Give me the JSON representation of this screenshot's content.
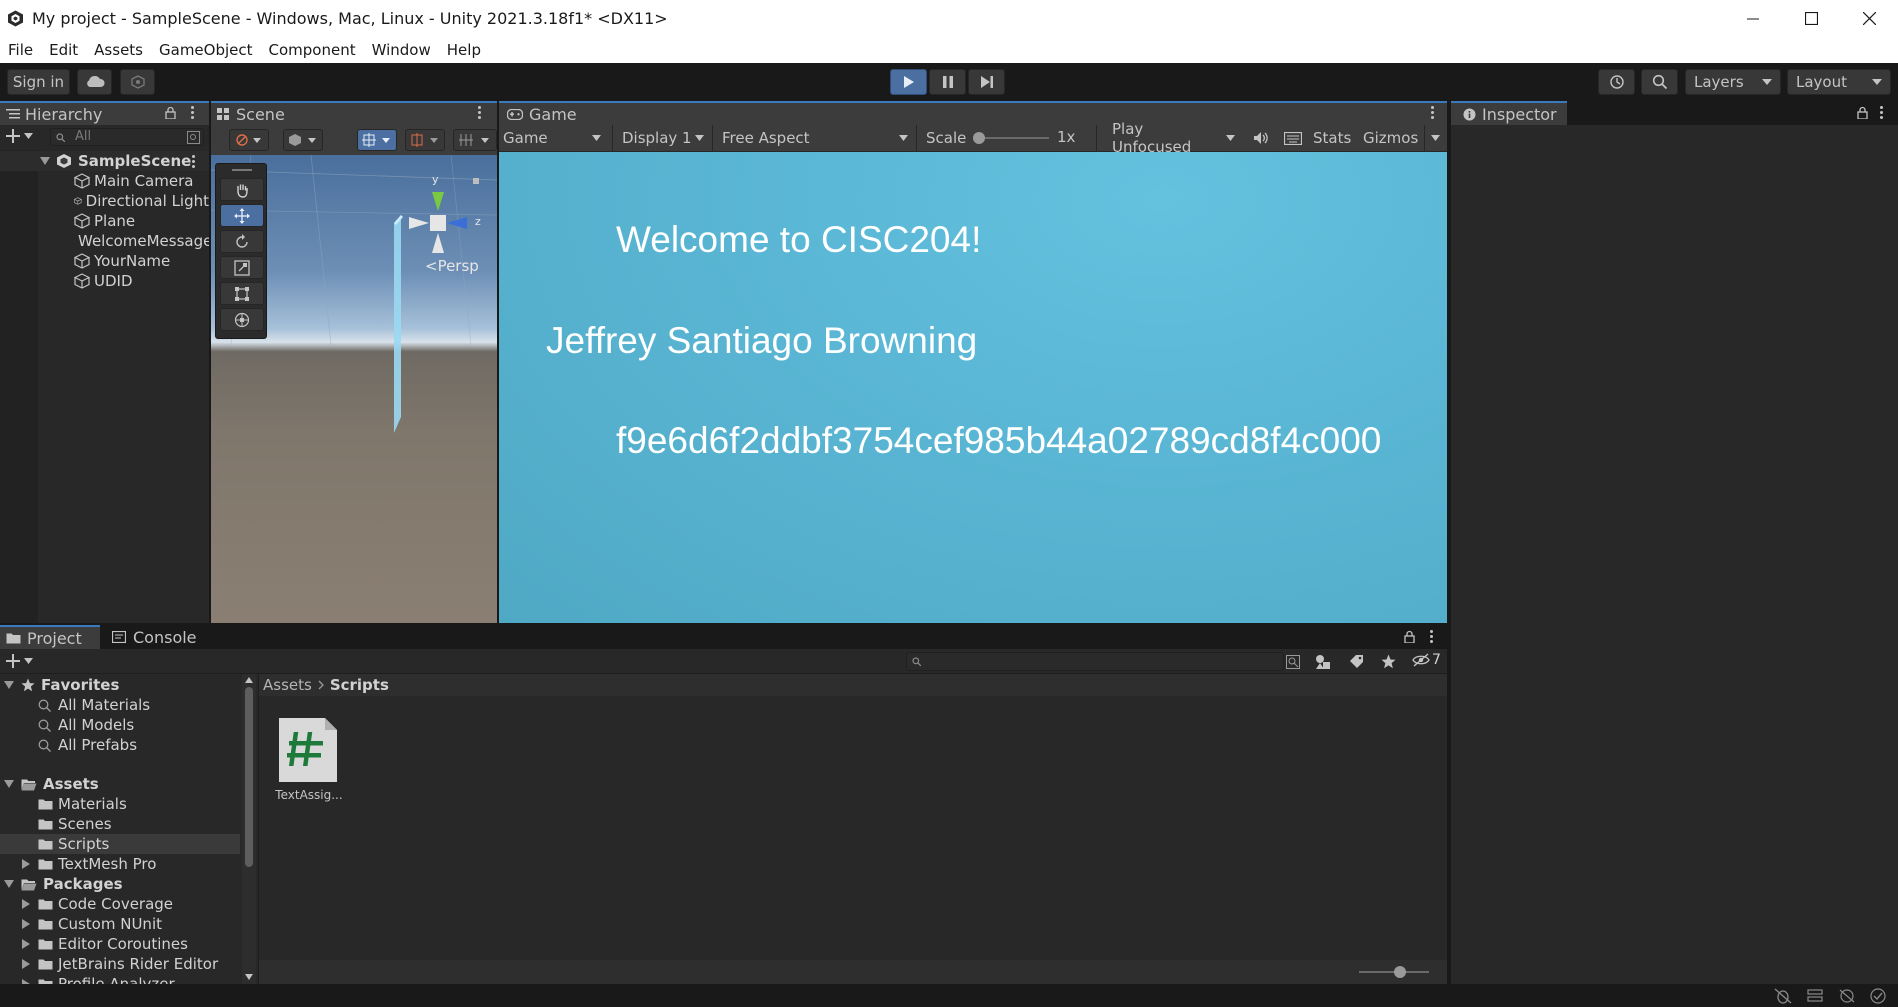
{
  "window": {
    "title": "My project - SampleScene - Windows, Mac, Linux - Unity 2021.3.18f1* <DX11>"
  },
  "menu": [
    "File",
    "Edit",
    "Assets",
    "GameObject",
    "Component",
    "Window",
    "Help"
  ],
  "toolbar": {
    "sign_in": "Sign in",
    "layers": "Layers",
    "layout": "Layout"
  },
  "hierarchy": {
    "tab": "Hierarchy",
    "search_placeholder": "All",
    "scene": "SampleScene",
    "items": [
      "Main Camera",
      "Directional Light",
      "Plane",
      "WelcomeMessage",
      "YourName",
      "UDID"
    ]
  },
  "scene": {
    "tab": "Scene",
    "persp_label": "<Persp",
    "gizmo_y": "y",
    "gizmo_z": "z"
  },
  "game": {
    "tab": "Game",
    "mode": "Game",
    "display": "Display 1",
    "aspect": "Free Aspect",
    "scale_label": "Scale",
    "scale_value": "1x",
    "play_mode": "Play Unfocused",
    "stats": "Stats",
    "gizmos": "Gizmos",
    "texts": {
      "welcome": "Welcome to CISC204!",
      "name": "Jeffrey Santiago Browning",
      "udid": "f9e6d6f2ddbf3754cef985b44a02789cd8f4c000"
    },
    "colors": {
      "sky": "#5bb8d6"
    }
  },
  "inspector": {
    "tab": "Inspector"
  },
  "project": {
    "tab": "Project",
    "console_tab": "Console",
    "hidden_count": "7",
    "breadcrumb": [
      "Assets",
      "Scripts"
    ],
    "favorites": {
      "label": "Favorites",
      "items": [
        "All Materials",
        "All Models",
        "All Prefabs"
      ]
    },
    "assets": {
      "label": "Assets",
      "items": [
        "Materials",
        "Scenes",
        "Scripts",
        "TextMesh Pro"
      ]
    },
    "packages": {
      "label": "Packages",
      "items": [
        "Code Coverage",
        "Custom NUnit",
        "Editor Coroutines",
        "JetBrains Rider Editor",
        "Profile Analyzer"
      ]
    },
    "files": [
      {
        "name": "TextAssig...",
        "icon": "csharp-script-icon"
      }
    ]
  },
  "colors": {
    "accent": "#3a79bb",
    "panel": "#282828",
    "tab_active": "#3c3c3c",
    "script_hash": "#1e7a3a"
  }
}
